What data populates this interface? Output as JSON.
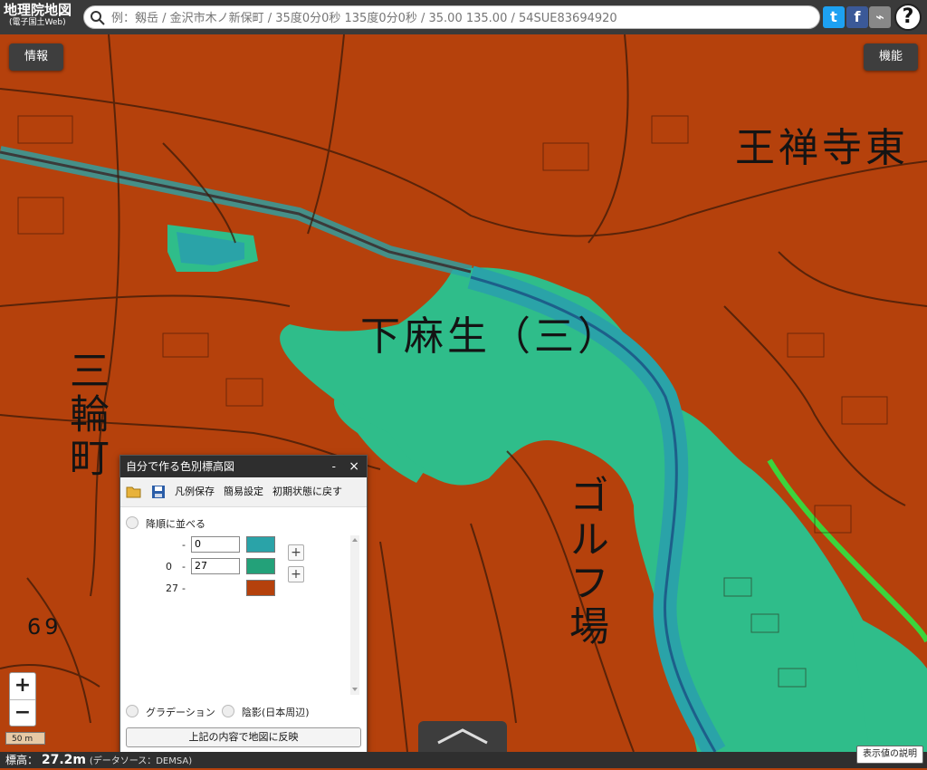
{
  "header": {
    "title": "地理院地図",
    "subtitle": "(電子国土Web)",
    "search_placeholder": "例：剱岳 / 金沢市木ノ新保町 / 35度0分0秒 135度0分0秒 / 35.00 135.00 / 54SUE83694920",
    "help": "?"
  },
  "buttons": {
    "info": "情報",
    "functions": "機能"
  },
  "map_labels": {
    "oushojihigashi": "王禅寺東",
    "shimoasao": "下麻生（三）",
    "miwacho": "三輪町",
    "golf": "ゴルフ場",
    "num69": "69"
  },
  "zoom": {
    "in": "+",
    "out": "−"
  },
  "scale": "50 m",
  "status": {
    "elev_label": "標高：",
    "elev_value": "27.2m",
    "source": "(データソース：DEMSA)",
    "explain": "表示値の説明"
  },
  "panel": {
    "title": "自分で作る色別標高図",
    "minimize": "-",
    "close": "×",
    "tools": {
      "save_legend": "凡例保存",
      "simple": "簡易設定",
      "reset": "初期状態に戻す"
    },
    "sort_desc": "降順に並べる",
    "rows": [
      {
        "from": "",
        "dash": "-",
        "value": "0",
        "color": "#2aa3a8"
      },
      {
        "from": "0",
        "dash": "-",
        "value": "27",
        "color": "#23a179"
      },
      {
        "from": "27",
        "dash": "-",
        "value": "",
        "color": "#b5410c"
      }
    ],
    "add": "+",
    "gradation": "グラデーション",
    "shade": "陰影(日本周辺)",
    "apply": "上記の内容で地図に反映"
  },
  "colors": {
    "land": "#b5410c",
    "low": "#2fbd8a",
    "water": "#2aa3a8"
  }
}
